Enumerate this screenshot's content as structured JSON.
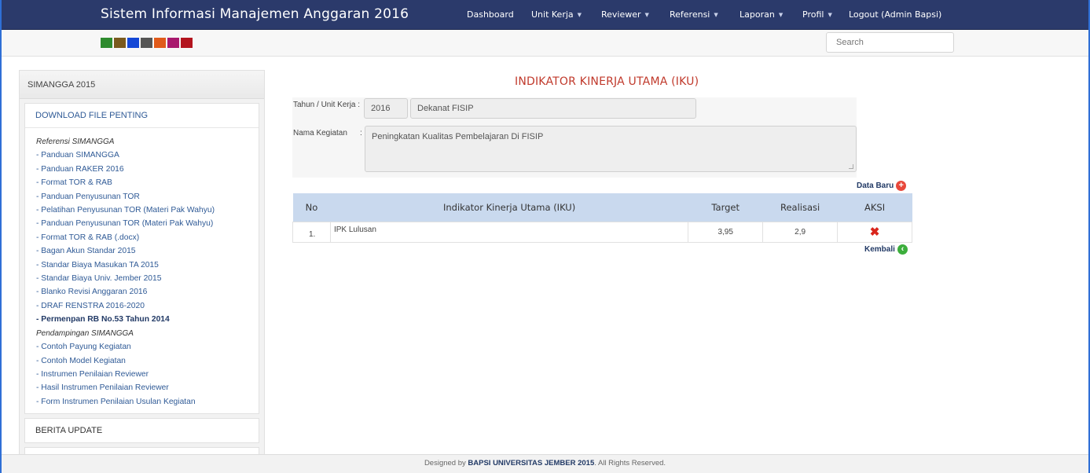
{
  "navbar": {
    "brand": "Sistem Informasi Manajemen Anggaran 2016",
    "items": [
      {
        "label": "Dashboard",
        "dropdown": false
      },
      {
        "label": "Unit Kerja",
        "dropdown": true
      },
      {
        "label": "Reviewer",
        "dropdown": true
      },
      {
        "label": "Referensi",
        "dropdown": true
      },
      {
        "label": "Laporan",
        "dropdown": true
      },
      {
        "label": "Profil",
        "dropdown": true
      },
      {
        "label": "Logout (Admin Bapsi)",
        "dropdown": false
      }
    ]
  },
  "theme_swatches": [
    "#2e8b2e",
    "#7a5a1e",
    "#1447d6",
    "#555555",
    "#e05a1a",
    "#a8196e",
    "#b3141e"
  ],
  "search": {
    "placeholder": "Search"
  },
  "sidebar": {
    "header": "SIMANGGA 2015",
    "download_title": "DOWNLOAD FILE PENTING",
    "sections": [
      {
        "title": "Referensi SIMANGGA",
        "links": [
          {
            "label": "- Panduan SIMANGGA",
            "bold": false
          },
          {
            "label": "- Panduan RAKER 2016",
            "bold": false
          },
          {
            "label": "- Format TOR & RAB",
            "bold": false
          },
          {
            "label": "- Panduan Penyusunan TOR",
            "bold": false
          },
          {
            "label": "- Pelatihan Penyusunan TOR (Materi Pak Wahyu)",
            "bold": false
          },
          {
            "label": "- Panduan Penyusunan TOR (Materi Pak Wahyu)",
            "bold": false
          },
          {
            "label": "- Format TOR & RAB (.docx)",
            "bold": false
          },
          {
            "label": "- Bagan Akun Standar 2015",
            "bold": false
          },
          {
            "label": "- Standar Biaya Masukan TA 2015",
            "bold": false
          },
          {
            "label": "- Standar Biaya Univ. Jember 2015",
            "bold": false
          },
          {
            "label": "- Blanko Revisi Anggaran 2016",
            "bold": false
          },
          {
            "label": "- DRAF RENSTRA 2016-2020",
            "bold": false
          },
          {
            "label": "- Permenpan RB No.53 Tahun 2014",
            "bold": true
          }
        ]
      },
      {
        "title": "Pendampingan SIMANGGA",
        "links": [
          {
            "label": "- Contoh Payung Kegiatan",
            "bold": false
          },
          {
            "label": "- Contoh Model Kegiatan",
            "bold": false
          },
          {
            "label": "- Instrumen Penilaian Reviewer",
            "bold": false
          },
          {
            "label": "- Hasil Instrumen Penilaian Reviewer",
            "bold": false
          },
          {
            "label": "- Form Instrumen Penilaian Usulan Kegiatan",
            "bold": false
          }
        ]
      }
    ],
    "berita_title": "BERITA UPDATE"
  },
  "main": {
    "title": "INDIKATOR KINERJA UTAMA (IKU)",
    "tahun_label": "Tahun / Unit Kerja :",
    "tahun_value": "2016",
    "unit_value": "Dekanat FISIP",
    "kegiatan_label": "Nama Kegiatan",
    "kegiatan_colon": ":",
    "kegiatan_value": "Peningkatan Kualitas Pembelajaran Di FISIP",
    "data_baru_label": "Data Baru",
    "kembali_label": "Kembali",
    "table": {
      "headers": [
        "No",
        "Indikator Kinerja Utama (IKU)",
        "Target",
        "Realisasi",
        "AKSI"
      ],
      "rows": [
        {
          "no": "1.",
          "iku": "IPK Lulusan",
          "target": "3,95",
          "realisasi": "2,9"
        }
      ]
    }
  },
  "footer": {
    "prefix": "Designed by",
    "org": "BAPSI UNIVERSITAS JEMBER 2015",
    "suffix": ". All Rights Reserved."
  },
  "colors": {
    "navbar": "#2b3a6b",
    "title_red": "#c0392b",
    "table_header": "#c9d9ee",
    "link_blue": "#2f5a96",
    "add_icon": "#e8483b",
    "back_icon": "#3cae3c"
  }
}
